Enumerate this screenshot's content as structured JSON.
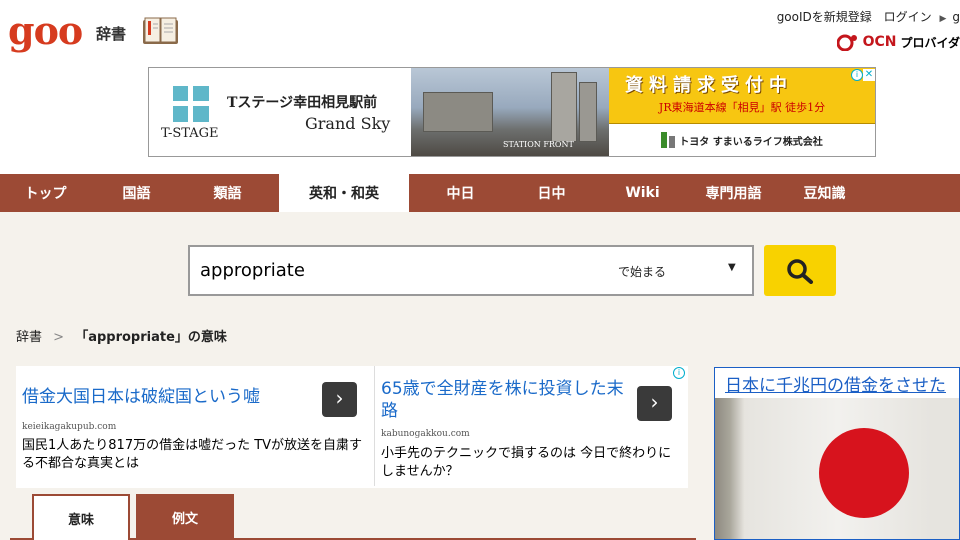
{
  "header": {
    "logo": "goo",
    "section": "辞書",
    "links": [
      "gooIDを新規登録",
      "ログイン",
      "g"
    ],
    "ocn_logo": "OCN",
    "ocn_text": "プロバイダ"
  },
  "top_ad": {
    "brand": "T-STAGE",
    "line1": "Tステージ幸田相見駅前",
    "line2": "Grand Sky",
    "photo_label": "STATION FRONT",
    "headline": "資料請求受付中",
    "sub": "JR東海道本線「相見」駅 徒歩1分",
    "company": "トヨタ すまいるライフ株式会社"
  },
  "nav": {
    "items": [
      "トップ",
      "国語",
      "類語",
      "英和・和英",
      "中日",
      "日中",
      "Wiki",
      "専門用語",
      "豆知識"
    ],
    "active_index": 3
  },
  "search": {
    "value": "appropriate",
    "mode": "で始まる",
    "mode_arrow": "▼"
  },
  "breadcrumb": {
    "root": "辞書",
    "separator": ">",
    "current": "「appropriate」の意味"
  },
  "mid_ads": [
    {
      "headline": "借金大国日本は破綻国という嘘",
      "domain": "keieikagakupub.com",
      "desc": "国民1人あたり817万の借金は嘘だった TVが放送を自粛する不都合な真実とは"
    },
    {
      "headline": "65歳で全財産を株に投資した末路",
      "domain": "kabunogakkou.com",
      "desc": "小手先のテクニックで損するのは 今日で終わりにしませんか？"
    }
  ],
  "tabs": [
    "意味",
    "例文"
  ],
  "right_ad": {
    "title": "日本に千兆円の借金をさせた"
  },
  "colors": {
    "brand": "#d63b1f",
    "nav": "#9c4a35",
    "search_button": "#f8d200",
    "link": "#1a6ac9"
  }
}
